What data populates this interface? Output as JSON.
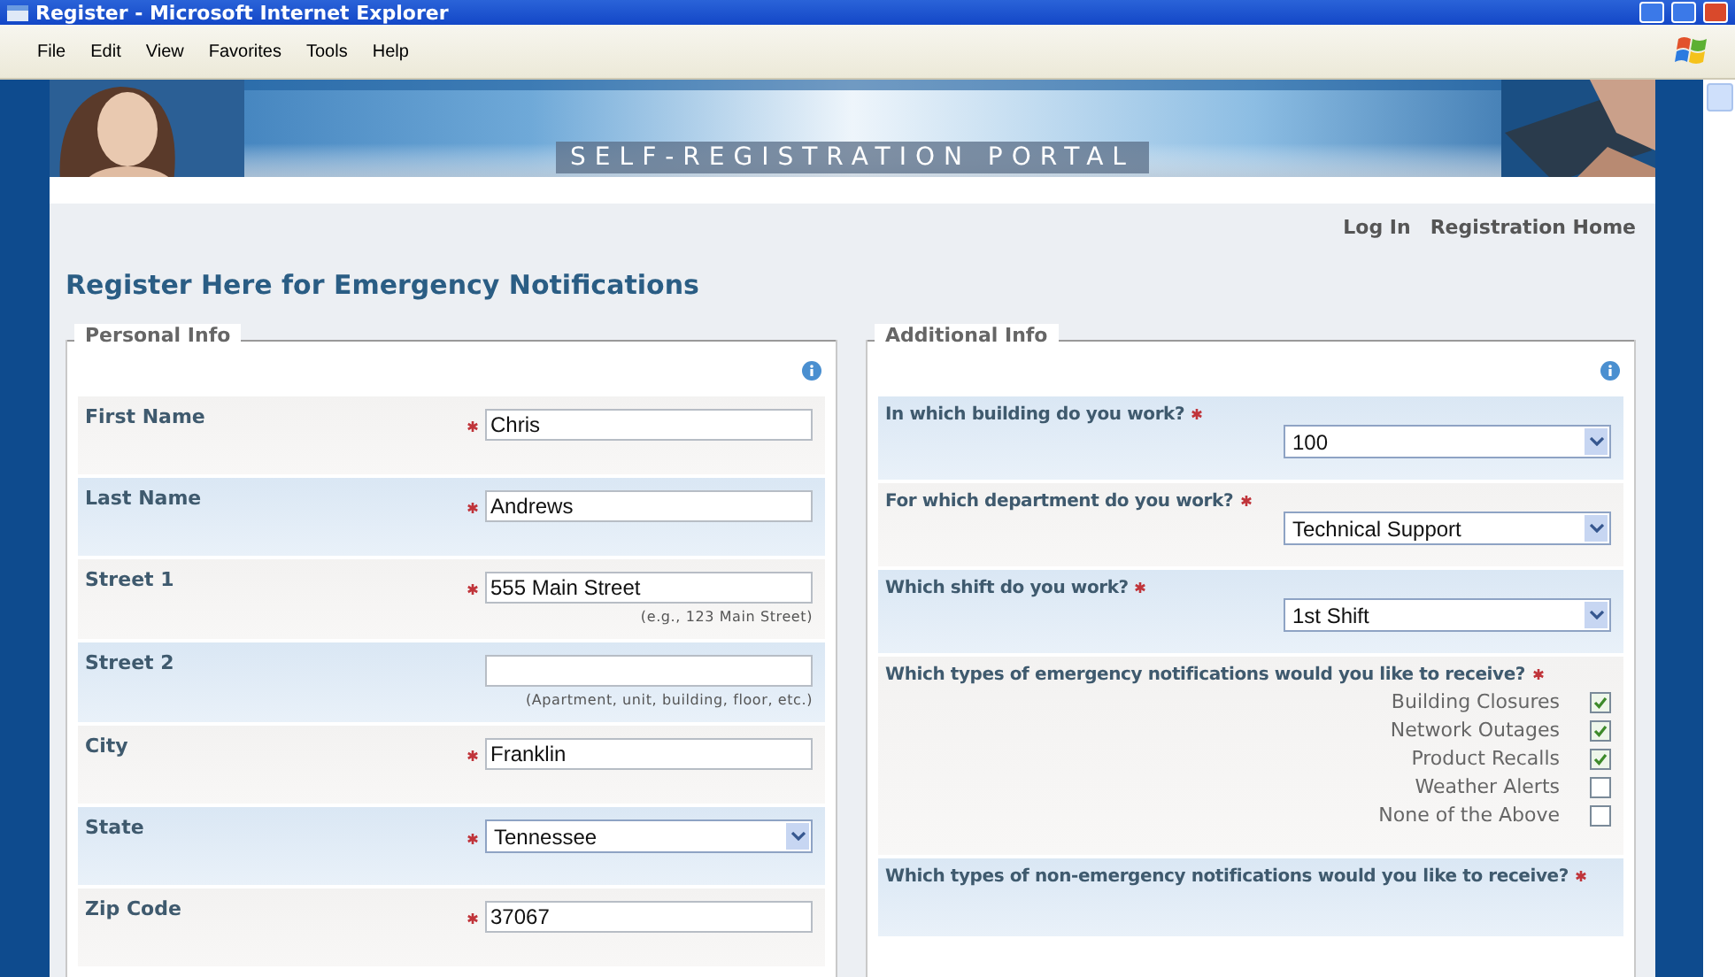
{
  "window": {
    "title": "Register - Microsoft Internet Explorer"
  },
  "menu": [
    "File",
    "Edit",
    "View",
    "Favorites",
    "Tools",
    "Help"
  ],
  "banner": {
    "title": "SELF-REGISTRATION PORTAL"
  },
  "top_links": [
    "Log In",
    "Registration Home"
  ],
  "heading": "Register Here for Emergency Notifications",
  "personal_info": {
    "legend": "Personal Info",
    "fields": [
      {
        "label": "First Name",
        "required": true,
        "kind": "text",
        "value": "Chris"
      },
      {
        "label": "Last Name",
        "required": true,
        "kind": "text",
        "value": "Andrews"
      },
      {
        "label": "Street 1",
        "required": true,
        "kind": "text",
        "value": "555 Main Street",
        "hint": "(e.g., 123 Main Street)"
      },
      {
        "label": "Street 2",
        "required": false,
        "kind": "text",
        "hint": "(Apartment, unit, building, floor, etc.)"
      },
      {
        "label": "City",
        "required": true,
        "kind": "text",
        "value": "Franklin"
      },
      {
        "label": "State",
        "required": true,
        "kind": "select",
        "value": "Tennessee"
      },
      {
        "label": "Zip Code",
        "required": true,
        "kind": "text",
        "value": "37067"
      }
    ]
  },
  "additional_info": {
    "legend": "Additional Info",
    "questions": [
      {
        "label": "In which building do you work?",
        "required": true,
        "kind": "select",
        "value": "100"
      },
      {
        "label": "For which department do you work?",
        "required": true,
        "kind": "select",
        "value": "Technical Support"
      },
      {
        "label": "Which shift do you work?",
        "required": true,
        "kind": "select",
        "value": "1st Shift"
      },
      {
        "label": "Which types of emergency notifications would you like to receive?",
        "required": true,
        "kind": "checkboxes",
        "options": [
          {
            "label": "Building Closures",
            "checked": true
          },
          {
            "label": "Network Outages",
            "checked": true
          },
          {
            "label": "Product Recalls",
            "checked": true
          },
          {
            "label": "Weather Alerts",
            "checked": false
          },
          {
            "label": "None of the Above",
            "checked": false
          }
        ]
      },
      {
        "label": "Which types of non-emergency notifications would you like to receive?",
        "required": true,
        "kind": "checkboxes"
      }
    ]
  }
}
